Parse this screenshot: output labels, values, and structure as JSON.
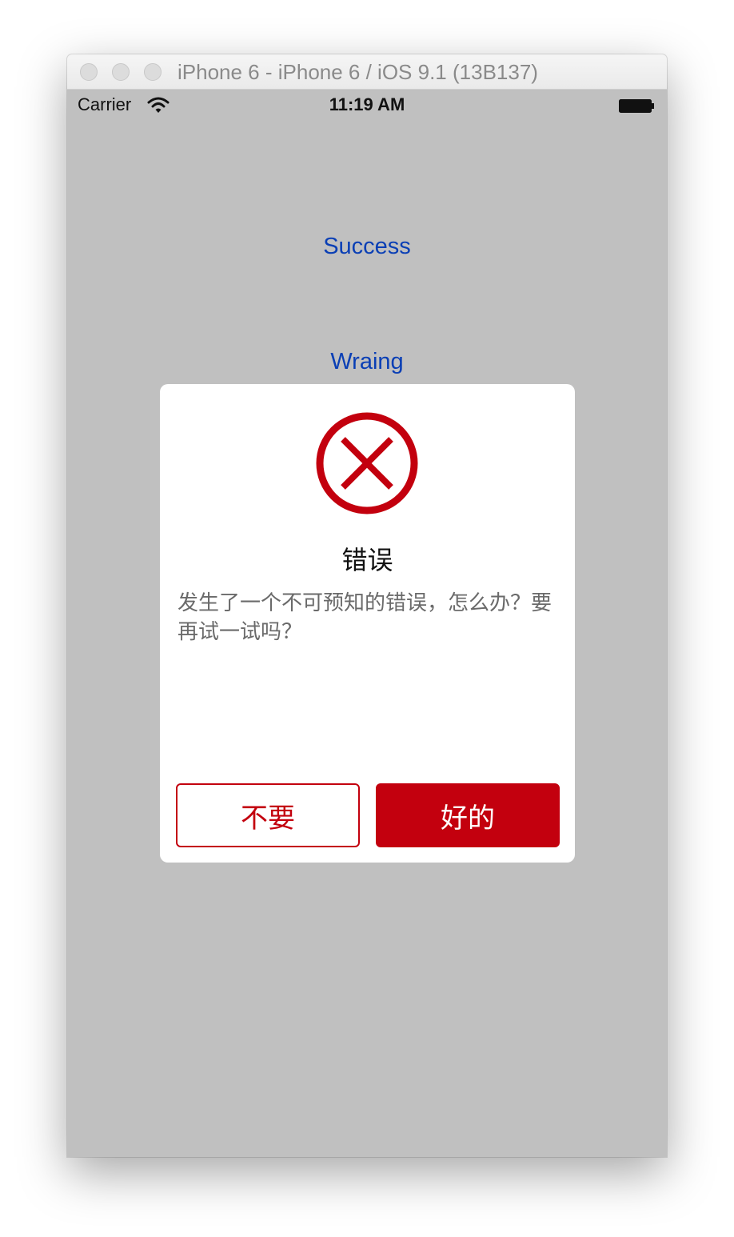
{
  "window": {
    "title": "iPhone 6 - iPhone 6 / iOS 9.1 (13B137)"
  },
  "status_bar": {
    "carrier": "Carrier",
    "time": "11:19 AM"
  },
  "main": {
    "success_label": "Success",
    "warning_label": "Wraing"
  },
  "alert": {
    "icon": "error-x-circle-icon",
    "title": "错误",
    "message": "发生了一个不可预知的错误，怎么办？要再试一试吗？",
    "cancel_label": "不要",
    "ok_label": "好的"
  },
  "colors": {
    "accent_red": "#c3000e",
    "link_blue": "#0a3fb5",
    "overlay_gray": "#c0c0c0"
  }
}
